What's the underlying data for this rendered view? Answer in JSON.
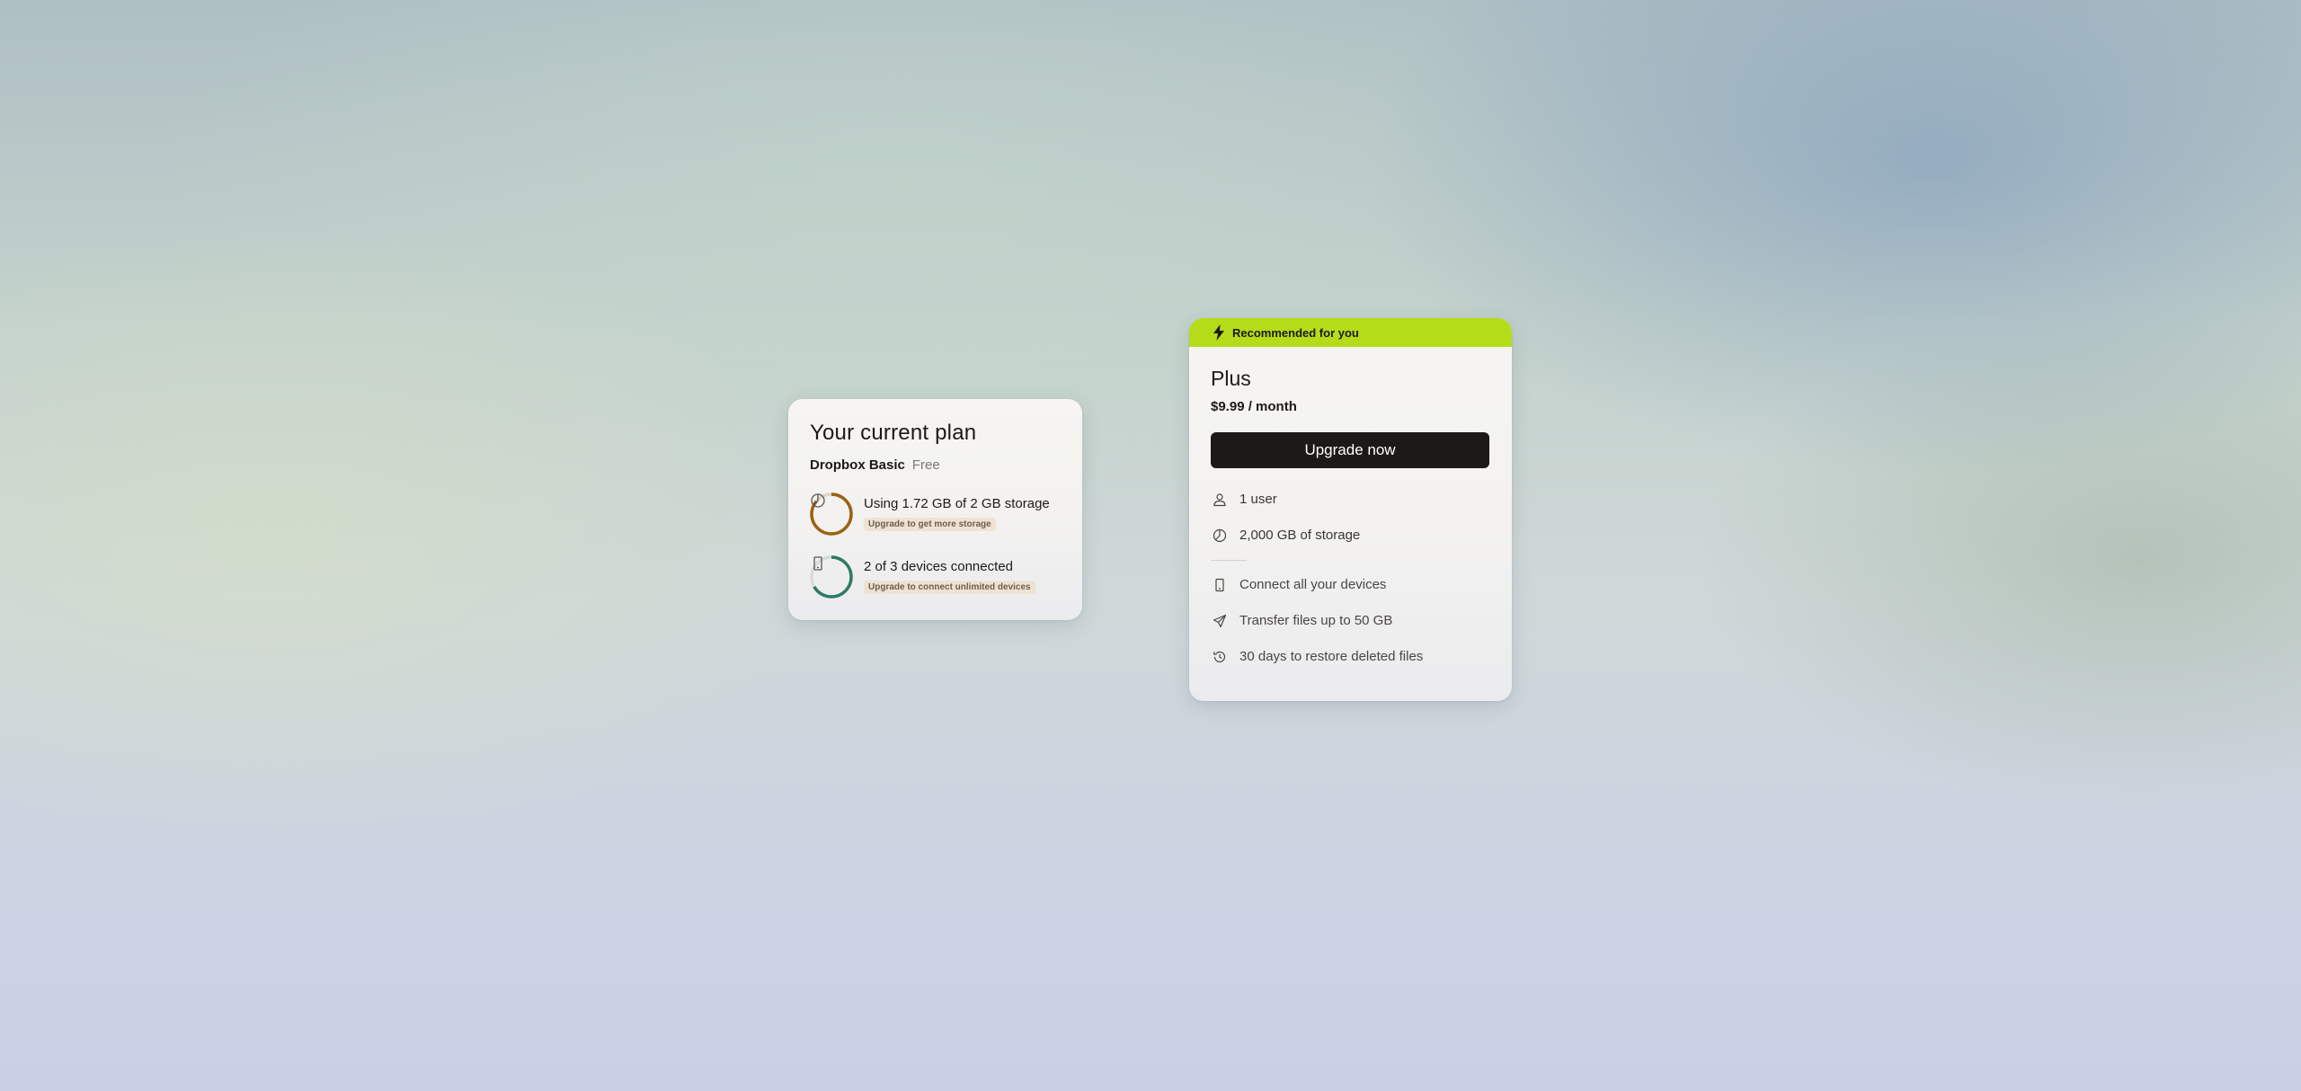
{
  "current_plan": {
    "title": "Your current plan",
    "plan_name": "Dropbox Basic",
    "plan_price": "Free",
    "storage": {
      "text": "Using 1.72 GB of 2 GB storage",
      "badge": "Upgrade to get more storage",
      "used_fraction": 0.86,
      "ring_color": "#9b6212",
      "icon": "pie-chart-icon"
    },
    "devices": {
      "text": "2 of 3 devices connected",
      "badge": "Upgrade to connect unlimited devices",
      "used_fraction": 0.6667,
      "ring_color": "#2e7a64",
      "icon": "phone-icon"
    }
  },
  "plus_plan": {
    "banner": "Recommended for you",
    "banner_color": "#b4dc19",
    "name": "Plus",
    "price": "$9.99 / month",
    "button_label": "Upgrade now",
    "features_primary": [
      {
        "icon": "user-icon",
        "label": "1 user"
      },
      {
        "icon": "storage-icon",
        "label": "2,000 GB of storage"
      }
    ],
    "features_secondary": [
      {
        "icon": "phone-icon",
        "label": "Connect all your devices"
      },
      {
        "icon": "send-icon",
        "label": "Transfer files up to 50 GB"
      },
      {
        "icon": "history-icon",
        "label": "30 days to restore deleted files"
      }
    ]
  }
}
